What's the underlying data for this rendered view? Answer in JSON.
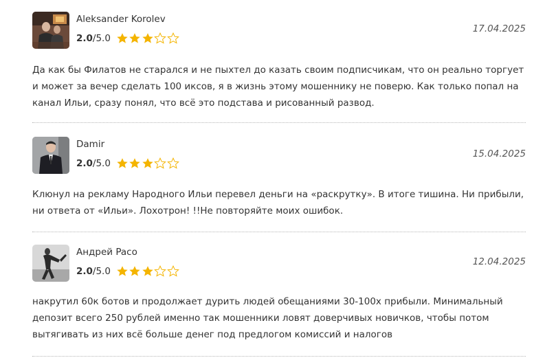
{
  "reviews": [
    {
      "author": "Aleksander Korolev",
      "rating_value": "2.0",
      "rating_max": "/5.0",
      "stars_filled": 3,
      "stars_total": 5,
      "date": "17.04.2025",
      "avatar_icon": "user-photo",
      "text": "Да как бы Филатов не старался и не пыхтел до казать своим подписчикам, что он реально торгует и может за вечер сделать 100 иксов, я в жизнь этому мошеннику не поверю. Как только попал на канал Ильи, сразу понял, что всё это подстава и рисованный развод."
    },
    {
      "author": "Damir",
      "rating_value": "2.0",
      "rating_max": "/5.0",
      "stars_filled": 3,
      "stars_total": 5,
      "date": "15.04.2025",
      "avatar_icon": "user-photo",
      "text": "Клюнул на рекламу Народного Ильи перевел деньги на «раскрутку». В итоге тишина. Ни прибыли, ни ответа от «Ильи». Лохотрон! !!Не повторяйте моих ошибок."
    },
    {
      "author": "Андрей Pacо",
      "rating_value": "2.0",
      "rating_max": "/5.0",
      "stars_filled": 3,
      "stars_total": 5,
      "date": "12.04.2025",
      "avatar_icon": "user-photo",
      "text": "накрутил 60к ботов и продолжает дурить людей обещаниями 30-100х прибыли. Минимальный депозит всего 250 рублей именно так мошенники ловят доверчивых новичков, чтобы потом вытягивать из них всё больше денег под предлогом комиссий и налогов"
    }
  ],
  "colors": {
    "star_filled": "#f4b400",
    "star_empty_stroke": "#f4b400",
    "text": "#333333",
    "date": "#555555",
    "divider": "#b5b5b5"
  }
}
